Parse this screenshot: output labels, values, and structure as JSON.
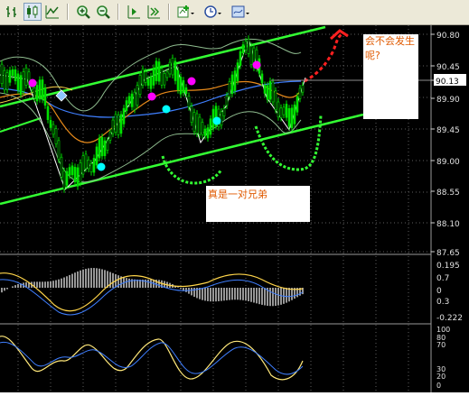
{
  "price_axis": {
    "labels": [
      "90.80",
      "90.45",
      "90.13",
      "89.90",
      "89.45",
      "89.00",
      "88.55",
      "88.10",
      "87.65"
    ],
    "current_price": "90.13"
  },
  "macd_axis": {
    "labels": [
      "0.195",
      "0.7",
      "0",
      "0.3",
      "-0.222"
    ]
  },
  "stoch_axis": {
    "labels": [
      "100",
      "80",
      "70",
      "30",
      "20",
      "0"
    ]
  },
  "annotations": {
    "question": "会不会发生呢?",
    "brothers": "真是一对兄弟"
  },
  "toolbar": {
    "icons": [
      "bar-chart-icon",
      "candlestick-icon",
      "line-chart-icon",
      "zoom-in-icon",
      "zoom-out-icon",
      "chart-shift-icon",
      "autoscroll-icon",
      "indicators-icon",
      "period-icon",
      "templates-icon"
    ]
  },
  "colors": {
    "background": "#000000",
    "grid": "#6e6e6e",
    "candles": "#00e000",
    "channel": "#33ff33",
    "bands": "#8fbc8f",
    "ma_blue": "#3f7fff",
    "ma_orange": "#e88a1a",
    "magenta_dots": "#ff00ff",
    "cyan_dots": "#00ffff",
    "projection": "#ff2020",
    "macd_signal": "#ffd54a",
    "stoch_main": "#ffe87a",
    "stoch_signal": "#3f7fff",
    "note_text": "#e05a00"
  }
}
